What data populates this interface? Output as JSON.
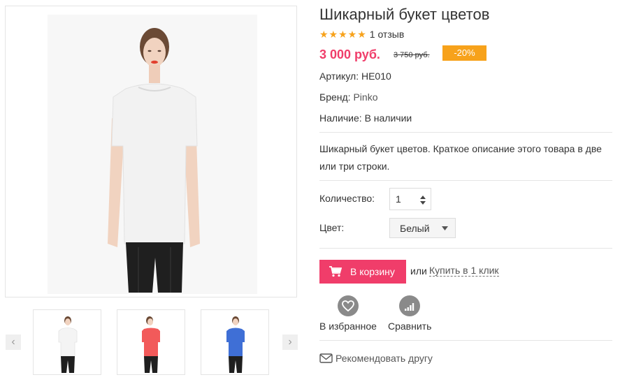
{
  "product": {
    "title": "Шикарный букет цветов",
    "rating_stars": "★★★★★",
    "reviews": "1 отзыв",
    "price": "3 000 руб.",
    "old_price": "3 750 руб.",
    "discount": "-20%",
    "sku": "Артикул: HE010",
    "brand_label": "Бренд: ",
    "brand": "Pinko",
    "availability": "Наличие: В наличии",
    "description": "Шикарный букет цветов. Краткое описание этого товара в две или три строки."
  },
  "options": {
    "quantity_label": "Количество:",
    "quantity_value": "1",
    "color_label": "Цвет:",
    "color_selected": "Белый"
  },
  "actions": {
    "add_to_cart": "В корзину",
    "or": "или",
    "one_click": "Купить в 1 клик",
    "favorites": "В избранное",
    "compare": "Сравнить",
    "recommend": "Рекомендовать другу"
  },
  "gallery": {
    "prev_icon": "chevron-left-icon",
    "next_icon": "chevron-right-icon",
    "thumbnails": [
      {
        "shirt_color": "#f4f4f4"
      },
      {
        "shirt_color": "#f25a5a"
      },
      {
        "shirt_color": "#3f6fd6"
      }
    ]
  },
  "colors": {
    "accent": "#f03d6a",
    "discount_badge": "#f7a21b",
    "stars": "#f7a21b"
  }
}
